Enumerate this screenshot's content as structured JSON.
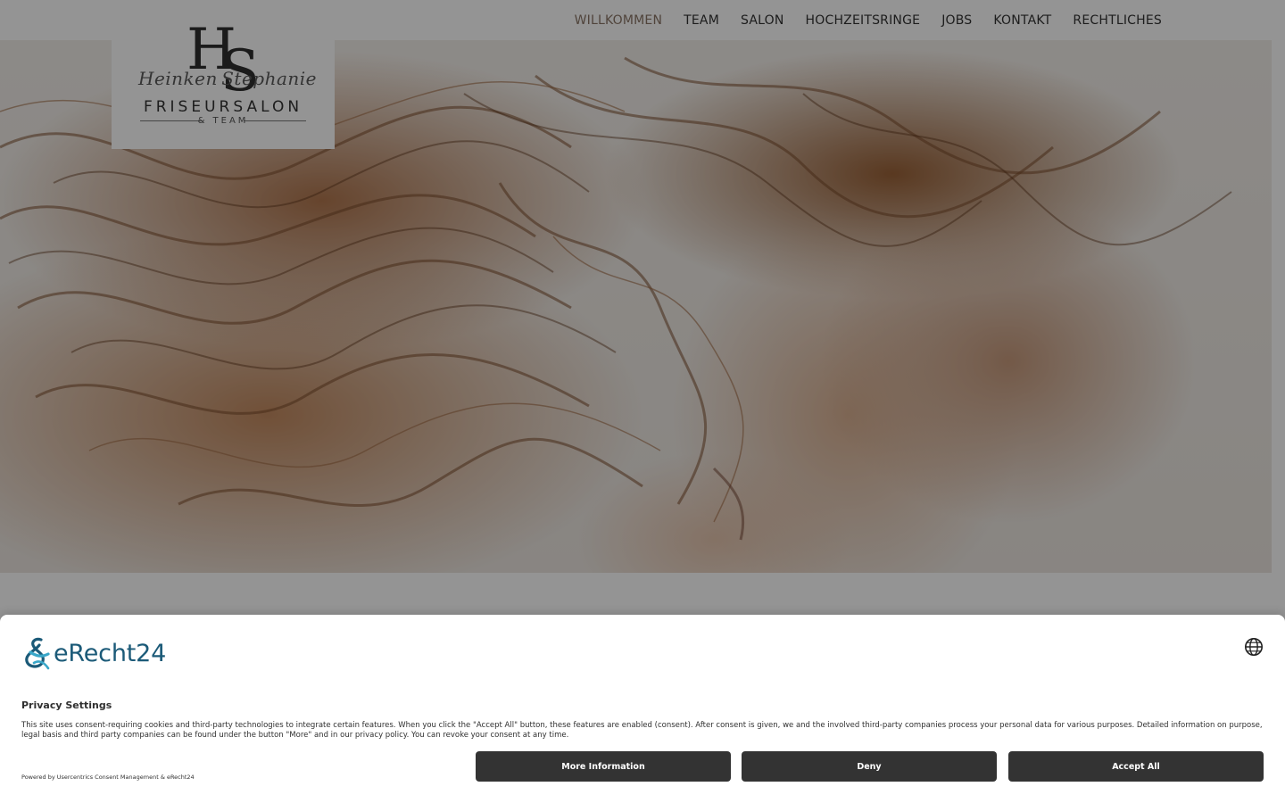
{
  "nav": {
    "items": [
      {
        "label": "WILLKOMMEN",
        "active": true
      },
      {
        "label": "TEAM"
      },
      {
        "label": "SALON"
      },
      {
        "label": "HOCHZEITSRINGE"
      },
      {
        "label": "JOBS"
      },
      {
        "label": "KONTAKT"
      },
      {
        "label": "RECHTLICHES"
      }
    ]
  },
  "logo": {
    "monogram_h": "H",
    "monogram_s": "S",
    "script_left": "Heinken",
    "script_right": "Stephanie",
    "title": "FRISEURSALON",
    "subtitle": "& TEAM"
  },
  "consent": {
    "brand": "eRecht24",
    "title": "Privacy Settings",
    "text": "This site uses consent-requiring cookies and third-party technologies to integrate certain features. When you click the \"Accept All\" button, these features are enabled (consent). After consent is given, we and the involved third-party companies process your personal data for various purposes. Detailed information on purpose, legal basis and third party companies can be found under the button \"More\" and in our privacy policy. You can revoke your consent at any time.",
    "powered_prefix": "Powered by ",
    "powered_link": "Usercentrics Consent Management",
    "powered_suffix": " & eRecht24",
    "buttons": {
      "more": "More Information",
      "deny": "Deny",
      "accept": "Accept All"
    }
  },
  "colors": {
    "nav_text": "#333333",
    "nav_active": "#8a7566",
    "button_bg": "#333333",
    "brand_blue": "#1b5a78"
  },
  "icons": {
    "language": "globe-icon",
    "brand": "erecht24-ampersand-logo"
  }
}
